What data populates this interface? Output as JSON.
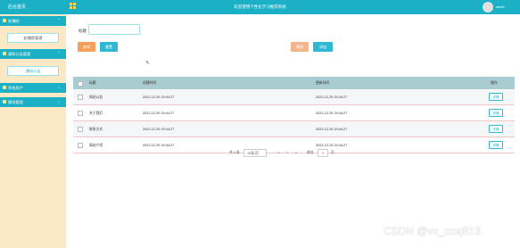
{
  "topbar": {
    "home": "后台首页",
    "title": "欢迎使用个性化学习推荐系统",
    "user": "admin"
  },
  "sidebar": {
    "groups": [
      {
        "label": "轮播图"
      },
      {
        "label": "通知公告管理"
      },
      {
        "label": "系统用户"
      },
      {
        "label": "模块管理"
      }
    ],
    "subs": [
      "轮播图管理",
      "通知公告"
    ]
  },
  "search": {
    "label": "标题",
    "search_btn": "查询",
    "reset_btn": "重置",
    "delete_btn": "删除",
    "add_btn": "添加"
  },
  "table": {
    "headers": [
      "标题",
      "创建时间",
      "更新时间",
      "操作"
    ],
    "rows": [
      {
        "title": "网站公告",
        "created": "2022-12-29 20:44:27",
        "updated": "2022-12-29 20:44:27",
        "action": "详情"
      },
      {
        "title": "关于我们",
        "created": "2022-12-29 20:44:27",
        "updated": "2022-12-29 20:44:27",
        "action": "详情"
      },
      {
        "title": "联系方式",
        "created": "2022-12-29 20:44:27",
        "updated": "2022-12-29 20:44:27",
        "action": "详情"
      },
      {
        "title": "网站介绍",
        "created": "2022-12-29 20:44:27",
        "updated": "2022-12-29 20:44:27",
        "action": "详情"
      }
    ]
  },
  "pager": {
    "total": "共 4 条",
    "page_size": "10条/页",
    "prev": "<",
    "page": "1",
    "next": ">",
    "goto": "前往",
    "goto_value": "1",
    "page_unit": "页"
  },
  "watermark": "CSDN @vx_cxsj813"
}
